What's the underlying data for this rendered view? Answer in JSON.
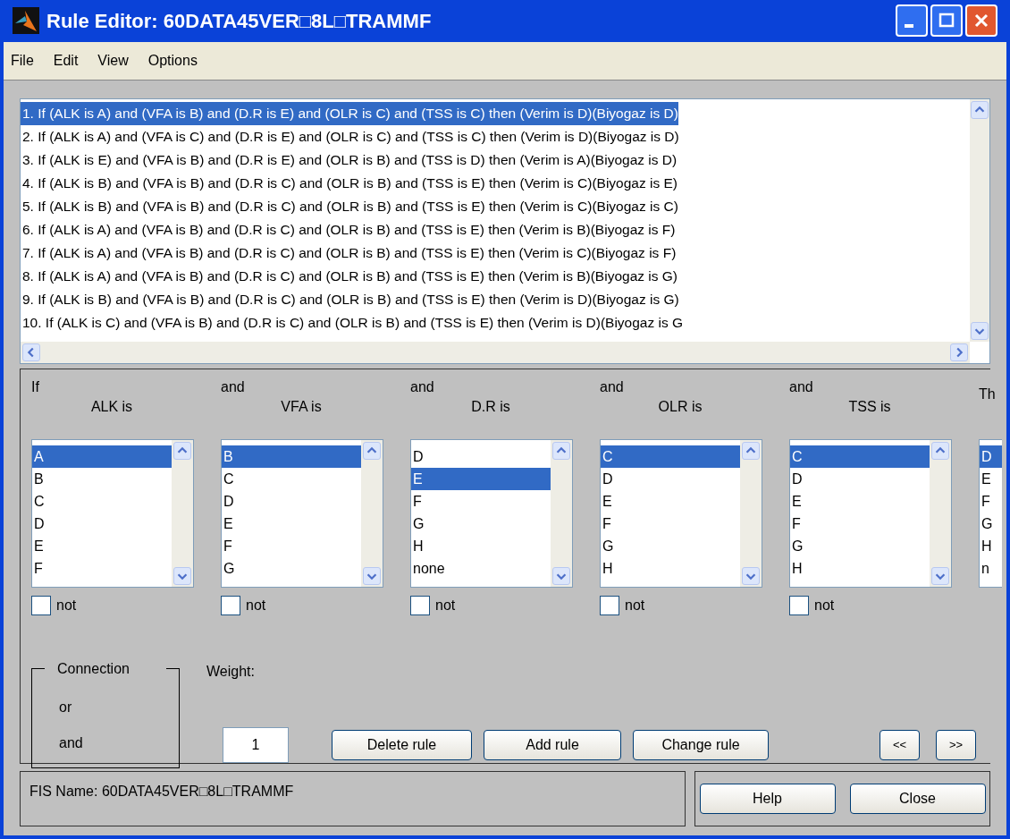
{
  "window": {
    "title": "Rule Editor: 60DATA45VER□8L□TRAMMF"
  },
  "menu": [
    "File",
    "Edit",
    "View",
    "Options"
  ],
  "rules": [
    {
      "text": "1. If (ALK is A) and (VFA is B) and (D.R is E) and (OLR is C) and (TSS is C) then (Verim is D)(Biyogaz is D)",
      "selected": true
    },
    {
      "text": "2. If (ALK is A) and (VFA is C) and (D.R is E) and (OLR is C) and (TSS is C) then (Verim is D)(Biyogaz is D)",
      "selected": false
    },
    {
      "text": "3. If (ALK is E) and (VFA is B) and (D.R is E) and (OLR is B) and (TSS is D) then (Verim is A)(Biyogaz is D)",
      "selected": false
    },
    {
      "text": "4. If (ALK is B) and (VFA is B) and (D.R is C) and (OLR is B) and (TSS is E) then (Verim is C)(Biyogaz is E)",
      "selected": false
    },
    {
      "text": "5. If (ALK is B) and (VFA is B) and (D.R is C) and (OLR is B) and (TSS is E) then (Verim is C)(Biyogaz is C)",
      "selected": false
    },
    {
      "text": "6. If (ALK is A) and (VFA is B) and (D.R is C) and (OLR is B) and (TSS is E) then (Verim is B)(Biyogaz is F)",
      "selected": false
    },
    {
      "text": "7. If (ALK is A) and (VFA is B) and (D.R is C) and (OLR is B) and (TSS is E) then (Verim is C)(Biyogaz is F)",
      "selected": false
    },
    {
      "text": "8. If (ALK is A) and (VFA is B) and (D.R is C) and (OLR is B) and (TSS is E) then (Verim is B)(Biyogaz is G)",
      "selected": false
    },
    {
      "text": "9. If (ALK is B) and (VFA is B) and (D.R is C) and (OLR is B) and (TSS is E) then (Verim is D)(Biyogaz is G)",
      "selected": false
    },
    {
      "text": "10. If (ALK is C) and (VFA is B) and (D.R is C) and (OLR is B) and (TSS is E) then (Verim is D)(Biyogaz is G",
      "selected": false
    }
  ],
  "variables": [
    {
      "prefix": "If",
      "label": "ALK is",
      "not_label": "not",
      "not_checked": false,
      "items": [
        {
          "text": "A",
          "selected": true
        },
        {
          "text": "B",
          "selected": false
        },
        {
          "text": "C",
          "selected": false
        },
        {
          "text": "D",
          "selected": false
        },
        {
          "text": "E",
          "selected": false
        },
        {
          "text": "F",
          "selected": false
        }
      ]
    },
    {
      "prefix": "and",
      "label": "VFA is",
      "not_label": "not",
      "not_checked": false,
      "items": [
        {
          "text": "B",
          "selected": true
        },
        {
          "text": "C",
          "selected": false
        },
        {
          "text": "D",
          "selected": false
        },
        {
          "text": "E",
          "selected": false
        },
        {
          "text": "F",
          "selected": false
        },
        {
          "text": "G",
          "selected": false
        }
      ]
    },
    {
      "prefix": "and",
      "label": "D.R is",
      "not_label": "not",
      "not_checked": false,
      "items": [
        {
          "text": "D",
          "selected": false
        },
        {
          "text": "E",
          "selected": true
        },
        {
          "text": "F",
          "selected": false
        },
        {
          "text": "G",
          "selected": false
        },
        {
          "text": "H",
          "selected": false
        },
        {
          "text": "none",
          "selected": false
        }
      ]
    },
    {
      "prefix": "and",
      "label": "OLR is",
      "not_label": "not",
      "not_checked": false,
      "items": [
        {
          "text": "C",
          "selected": true
        },
        {
          "text": "D",
          "selected": false
        },
        {
          "text": "E",
          "selected": false
        },
        {
          "text": "F",
          "selected": false
        },
        {
          "text": "G",
          "selected": false
        },
        {
          "text": "H",
          "selected": false
        }
      ]
    },
    {
      "prefix": "and",
      "label": "TSS is",
      "not_label": "not",
      "not_checked": false,
      "items": [
        {
          "text": "C",
          "selected": true
        },
        {
          "text": "D",
          "selected": false
        },
        {
          "text": "E",
          "selected": false
        },
        {
          "text": "F",
          "selected": false
        },
        {
          "text": "G",
          "selected": false
        },
        {
          "text": "H",
          "selected": false
        }
      ]
    }
  ],
  "then_column": {
    "label": "Th",
    "items": [
      {
        "text": "D",
        "selected": true
      },
      {
        "text": "E",
        "selected": false
      },
      {
        "text": "F",
        "selected": false
      },
      {
        "text": "G",
        "selected": false
      },
      {
        "text": "H",
        "selected": false
      },
      {
        "text": "n",
        "selected": false
      }
    ]
  },
  "connection": {
    "title": "Connection",
    "options": [
      "or",
      "and"
    ]
  },
  "weight": {
    "label": "Weight:",
    "value": "1"
  },
  "buttons": [
    "Delete rule",
    "Add rule",
    "Change rule"
  ],
  "nav_buttons": [
    "<<",
    ">>"
  ],
  "fis_name": "FIS Name: 60DATA45VER□8L□TRAMMF",
  "footer_buttons": [
    "Help",
    "Close"
  ]
}
